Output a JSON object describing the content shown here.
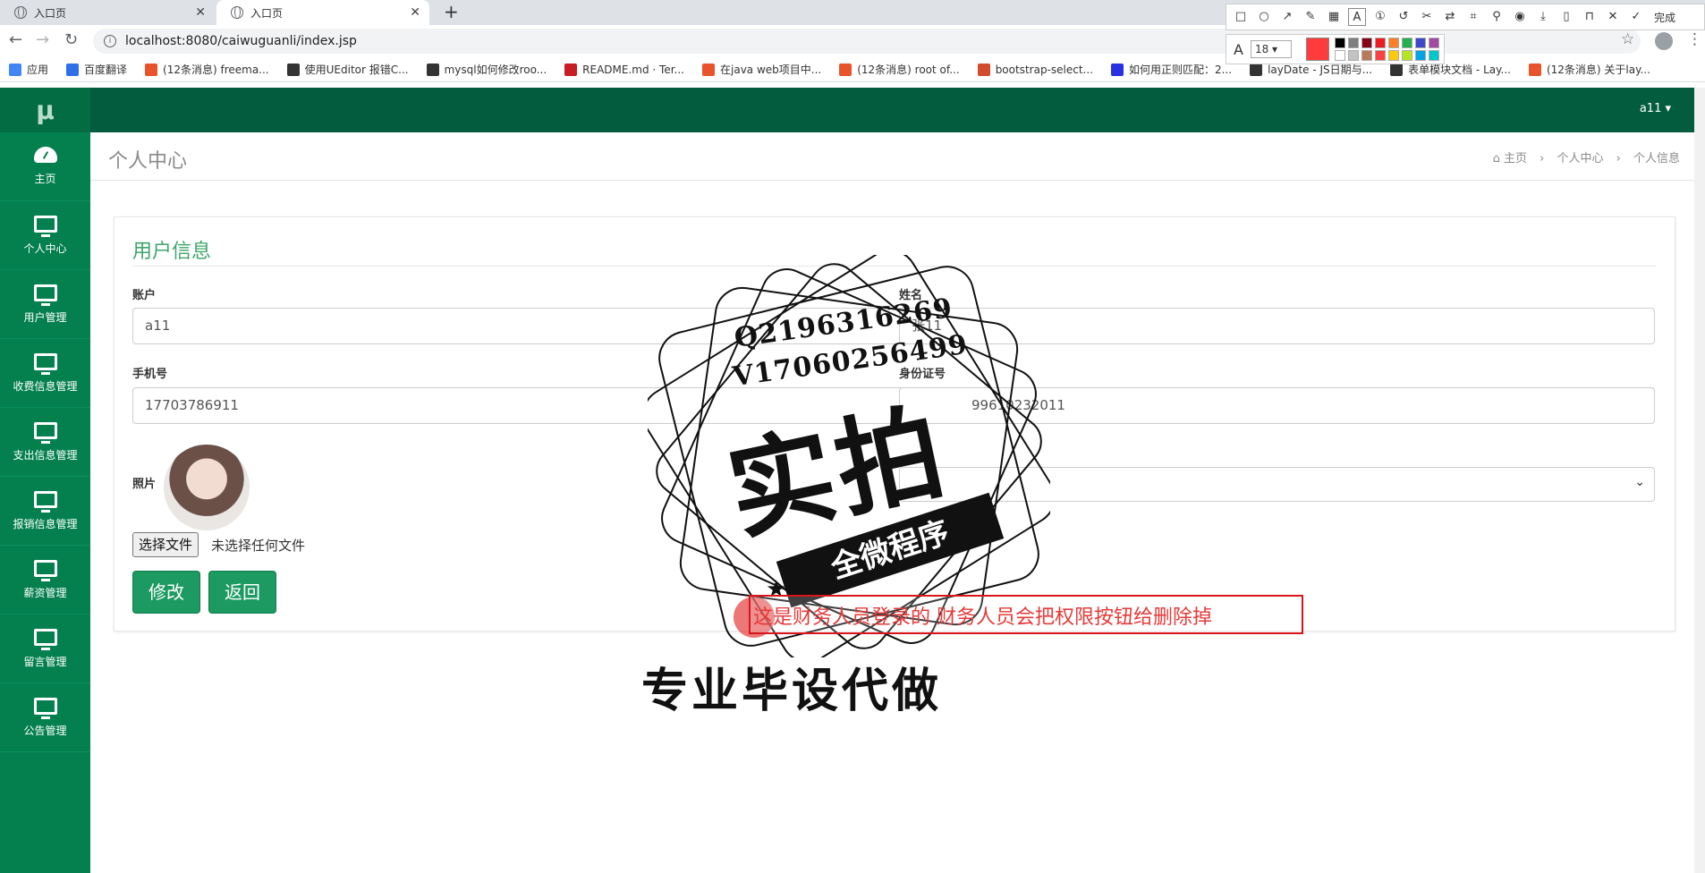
{
  "browser": {
    "tabs": [
      {
        "title": "入口页"
      },
      {
        "title": "入口页"
      }
    ],
    "url": "localhost:8080/caiwuguanli/index.jsp",
    "bookmarks": [
      {
        "label": "应用",
        "color": "#4285f4"
      },
      {
        "label": "百度翻译",
        "color": "#2f6fe8"
      },
      {
        "label": "(12条消息) freema...",
        "color": "#e9532b"
      },
      {
        "label": "使用UEditor 报错C...",
        "color": "#333333"
      },
      {
        "label": "mysql如何修改roo...",
        "color": "#333333"
      },
      {
        "label": "README.md · Ter...",
        "color": "#c71d23"
      },
      {
        "label": "在java web项目中...",
        "color": "#e9532b"
      },
      {
        "label": "(12条消息) root of...",
        "color": "#e9532b"
      },
      {
        "label": "bootstrap-select...",
        "color": "#d14b2e"
      },
      {
        "label": "如何用正则匹配：2...",
        "color": "#2932e1"
      },
      {
        "label": "layDate - JS日期与...",
        "color": "#333333"
      },
      {
        "label": "表单模块文档 - Lay...",
        "color": "#333333"
      },
      {
        "label": "(12条消息) 关于lay...",
        "color": "#e9532b"
      }
    ]
  },
  "snip_tool": {
    "done_label": "完成",
    "font_size": "18",
    "current_color": "#ff3b3b",
    "palette": [
      "#000000",
      "#7f7f7f",
      "#880015",
      "#ed1c24",
      "#ff7f27",
      "#22b14c",
      "#3f48cc",
      "#a349a4",
      "#ffffff",
      "#c3c3c3",
      "#b97a57",
      "#ff4040",
      "#ffc90e",
      "#b5e61d",
      "#00a2e8",
      "#00c8c8"
    ]
  },
  "app": {
    "logo": "μ",
    "user": "a11 ▾",
    "sidebar": [
      {
        "label": "主页",
        "icon": "dashboard-icon"
      },
      {
        "label": "个人中心",
        "icon": "monitor-icon"
      },
      {
        "label": "用户管理",
        "icon": "monitor-icon"
      },
      {
        "label": "收费信息管理",
        "icon": "monitor-icon"
      },
      {
        "label": "支出信息管理",
        "icon": "monitor-icon"
      },
      {
        "label": "报销信息管理",
        "icon": "monitor-icon"
      },
      {
        "label": "薪资管理",
        "icon": "monitor-icon"
      },
      {
        "label": "留言管理",
        "icon": "monitor-icon"
      },
      {
        "label": "公告管理",
        "icon": "monitor-icon"
      }
    ],
    "page_title": "个人中心",
    "breadcrumb": [
      "主页",
      "个人中心",
      "个人信息"
    ],
    "card_title": "用户信息",
    "form": {
      "account_label": "账户",
      "account_value": "a11",
      "name_label": "姓名",
      "name_value": "张11",
      "phone_label": "手机号",
      "phone_value": "17703786911",
      "id_label": "身份证号",
      "id_value": "99610232011",
      "photo_label": "照片",
      "file_button": "选择文件",
      "file_status": "未选择任何文件",
      "submit_label": "修改",
      "back_label": "返回"
    },
    "footer_partial": "专业毕设代做"
  },
  "overlay": {
    "stamp_line1": "Q2196316269",
    "stamp_line2": "V17060256499",
    "stamp_big": "实拍",
    "stamp_banner": "全微程序",
    "annotation": "这是财务人员登录的 财务人员会把权限按钮给删除掉"
  }
}
